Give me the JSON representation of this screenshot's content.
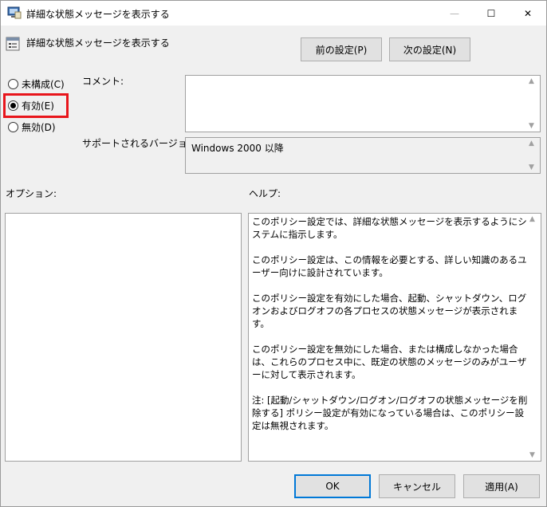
{
  "window": {
    "title": "詳細な状態メッセージを表示する",
    "controls": {
      "minimize": "—",
      "maximize": "☐",
      "close": "✕"
    }
  },
  "header": {
    "policy_name": "詳細な状態メッセージを表示する",
    "prev_button": "前の設定(P)",
    "next_button": "次の設定(N)"
  },
  "state": {
    "options": [
      {
        "label": "未構成(C)",
        "selected": false
      },
      {
        "label": "有効(E)",
        "selected": true
      },
      {
        "label": "無効(D)",
        "selected": false
      }
    ],
    "highlight_color": "#e8151b"
  },
  "comment": {
    "label": "コメント:",
    "value": ""
  },
  "supported": {
    "label": "サポートされるバージョン:",
    "value": "Windows 2000 以降"
  },
  "options_section": {
    "label": "オプション:"
  },
  "help_section": {
    "label": "ヘルプ:",
    "text": "このポリシー設定では、詳細な状態メッセージを表示するようにシステムに指示します。\n\nこのポリシー設定は、この情報を必要とする、詳しい知識のあるユーザー向けに設計されています。\n\nこのポリシー設定を有効にした場合、起動、シャットダウン、ログオンおよびログオフの各プロセスの状態メッセージが表示されます。\n\nこのポリシー設定を無効にした場合、または構成しなかった場合は、これらのプロセス中に、既定の状態のメッセージのみがユーザーに対して表示されます。\n\n注: [起動/シャットダウン/ログオン/ログオフの状態メッセージを削除する] ポリシー設定が有効になっている場合は、このポリシー設定は無視されます。"
  },
  "footer": {
    "ok": "OK",
    "cancel": "キャンセル",
    "apply": "適用(A)"
  },
  "colors": {
    "accent": "#0078d7"
  }
}
